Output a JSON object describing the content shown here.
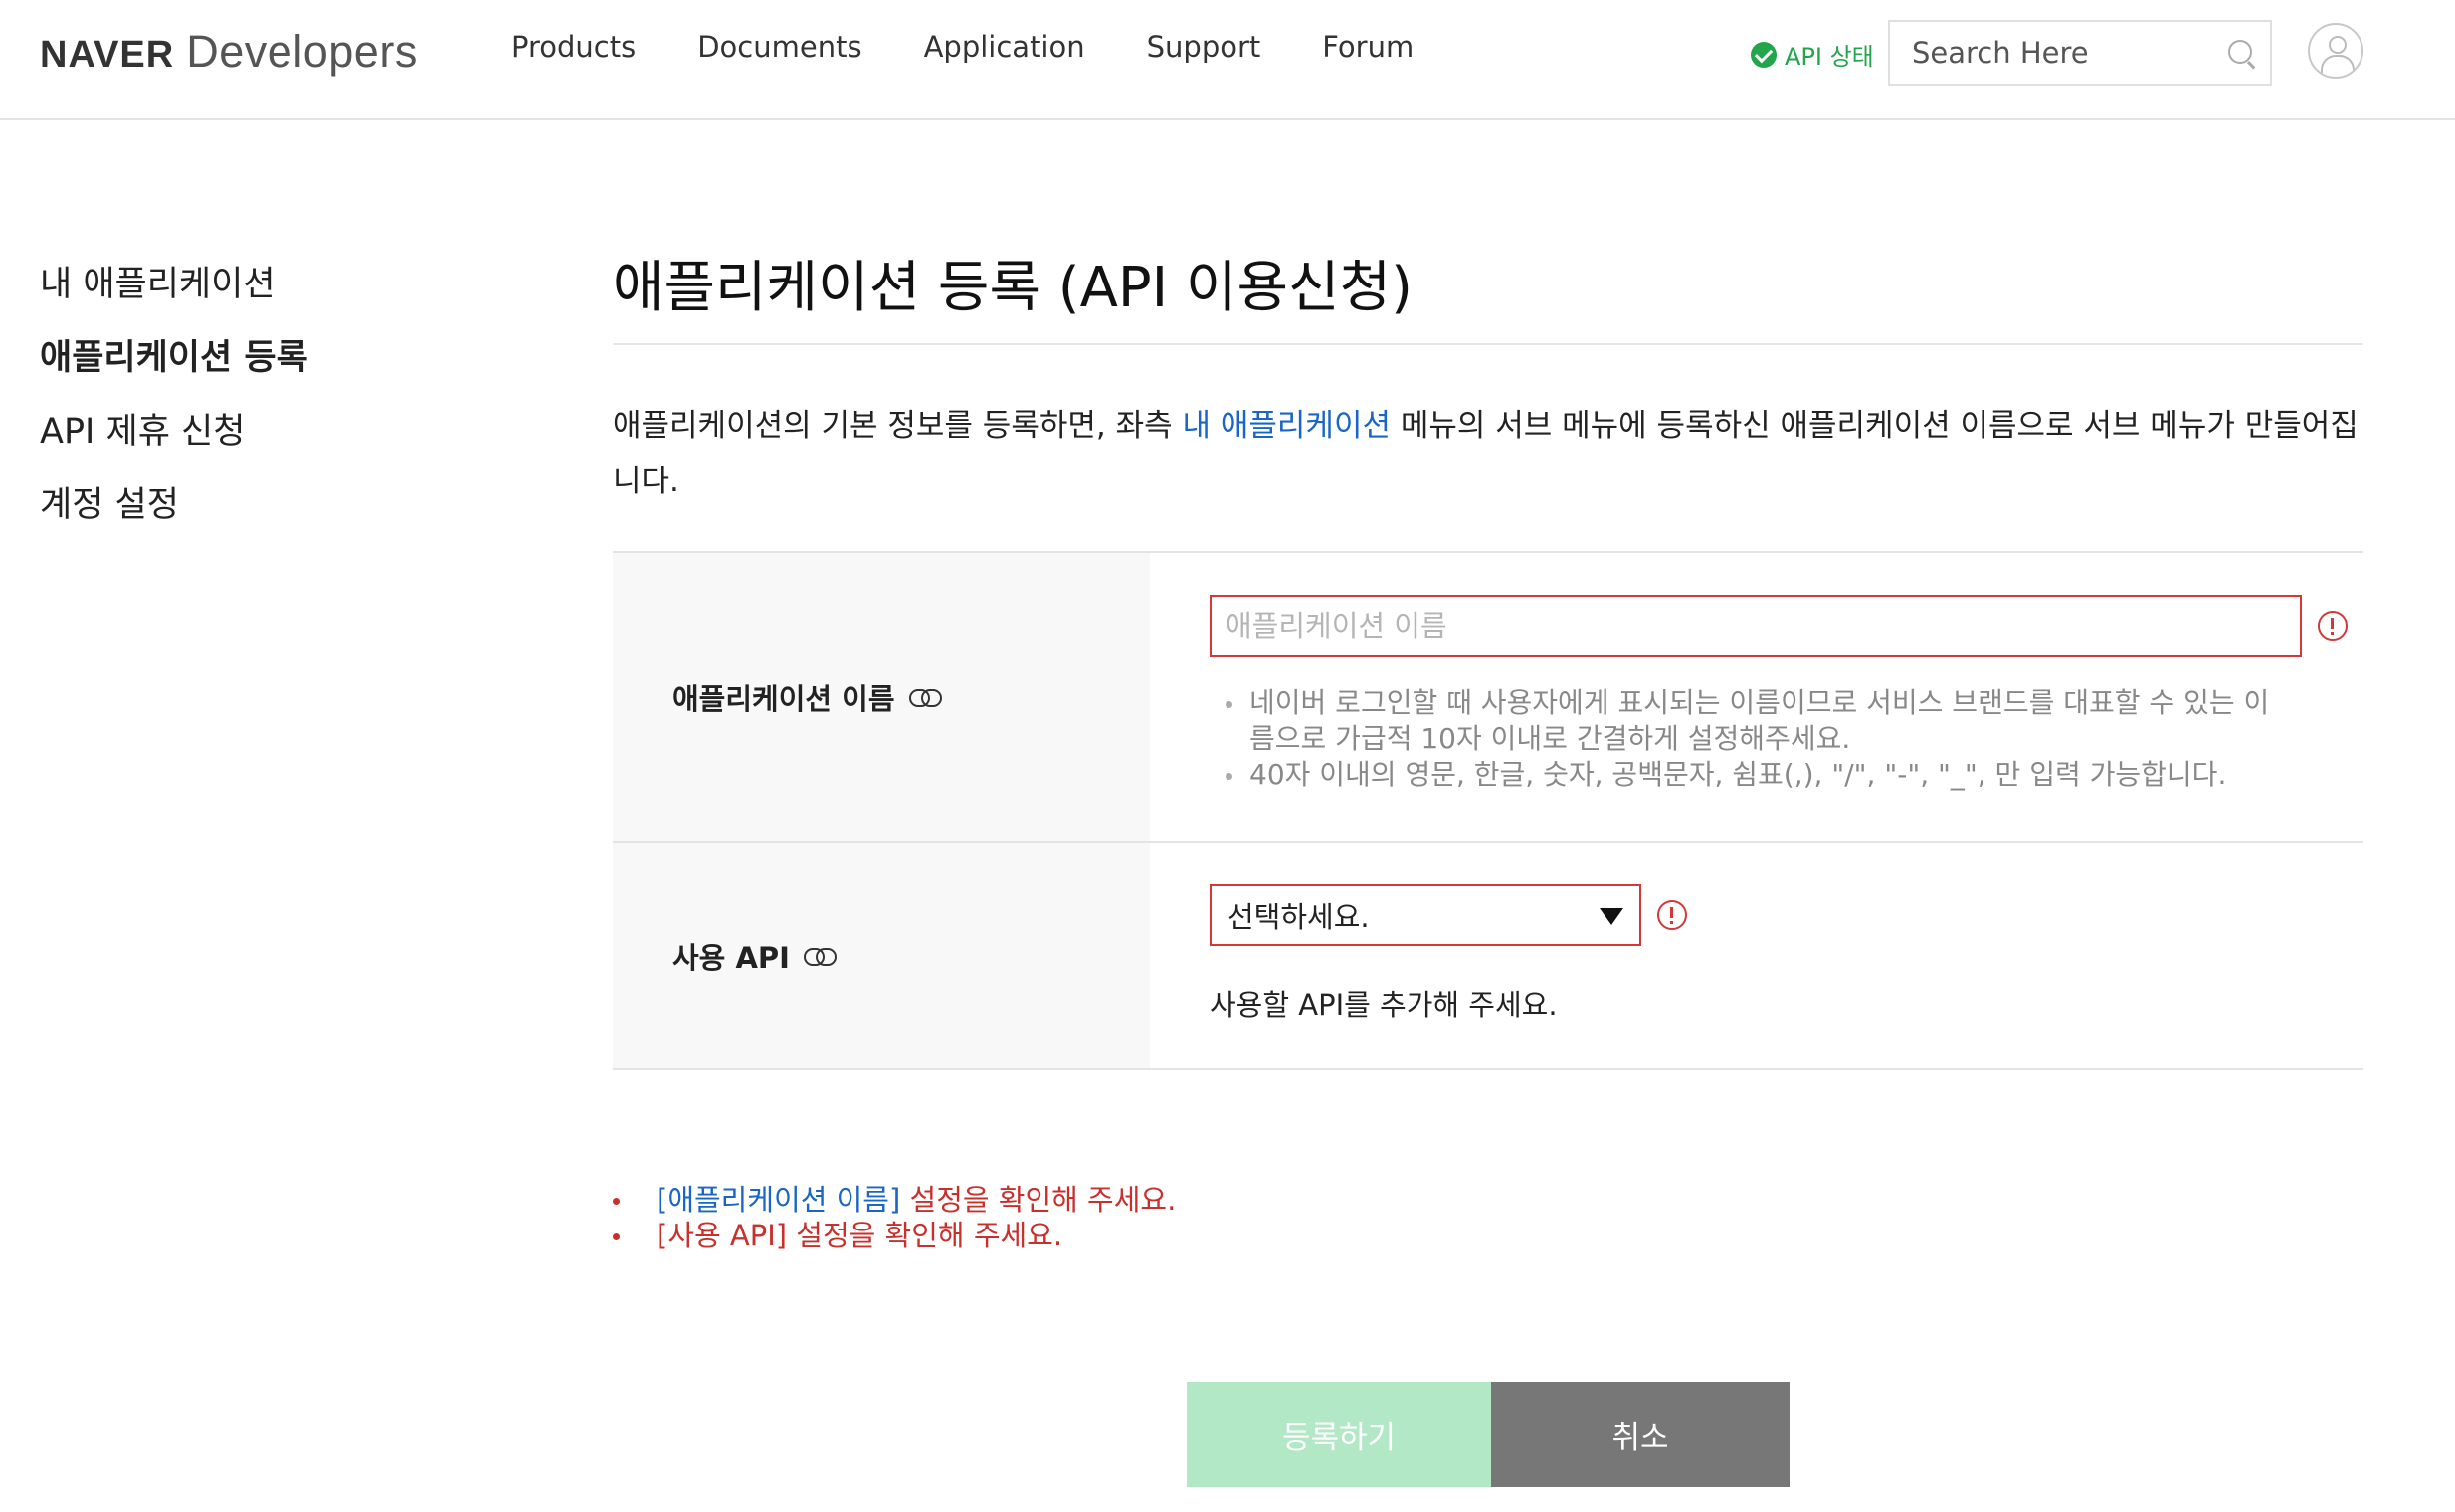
{
  "header": {
    "logo_bold": "NAVER",
    "logo_light": "Developers",
    "nav": [
      "Products",
      "Documents",
      "Application",
      "Support",
      "Forum"
    ],
    "api_status": "API 상태",
    "search_placeholder": "Search Here"
  },
  "sidebar": {
    "items": [
      {
        "label": "내 애플리케이션"
      },
      {
        "label": "애플리케이션 등록"
      },
      {
        "label": "API 제휴 신청"
      },
      {
        "label": "계정 설정"
      }
    ]
  },
  "main": {
    "title": "애플리케이션 등록 (API 이용신청)",
    "desc_before": "애플리케이션의 기본 정보를 등록하면, 좌측 ",
    "desc_link": "내 애플리케이션",
    "desc_after": " 메뉴의 서브 메뉴에 등록하신 애플리케이션 이름으로 서브 메뉴가 만들어집니다."
  },
  "form": {
    "app_name_label": "애플리케이션 이름",
    "app_name_placeholder": "애플리케이션 이름",
    "app_name_hints": [
      "네이버 로그인할 때 사용자에게 표시되는 이름이므로 서비스 브랜드를 대표할 수 있는 이름으로 가급적 10자 이내로 간결하게 설정해주세요.",
      "40자 이내의 영문, 한글, 숫자, 공백문자, 쉼표(,), \"/\", \"-\", \"_\", 만 입력 가능합니다."
    ],
    "api_label": "사용 API",
    "api_select_value": "선택하세요.",
    "api_help": "사용할 API를 추가해 주세요."
  },
  "errors": {
    "e1_field": "[애플리케이션 이름]",
    "e1_msg": " 설정을 확인해 주세요.",
    "e2_msg": "[사용 API] 설정을 확인해 주세요."
  },
  "buttons": {
    "register": "등록하기",
    "cancel": "취소"
  },
  "colors": {
    "accent_link": "#1a66c7",
    "error": "#d43838",
    "status_ok": "#22a54b",
    "register_btn": "#b3e8c7",
    "cancel_btn": "#777777"
  }
}
